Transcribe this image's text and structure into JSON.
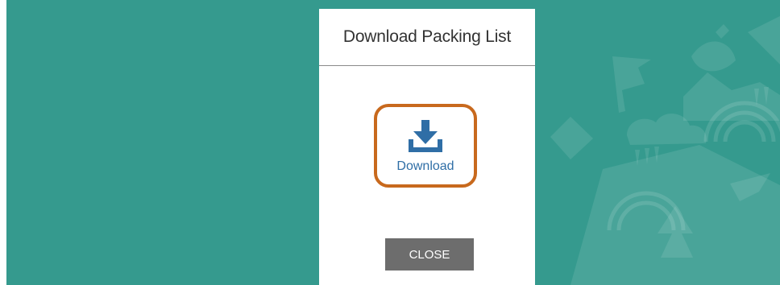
{
  "dialog": {
    "title": "Download Packing List",
    "download_label": "Download",
    "close_label": "CLOSE"
  },
  "icons": {
    "download": "download-tray-icon"
  },
  "colors": {
    "backdrop": "#359a8e",
    "tile_border": "#c8691d",
    "icon_blue": "#2f6ea6",
    "close_button": "#6d6d6d"
  }
}
